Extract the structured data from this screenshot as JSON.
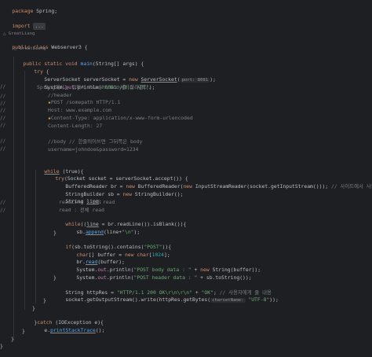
{
  "colors": {
    "background": "#1e1f22",
    "keyword": "#cf8e6d",
    "method": "#56a8f5",
    "string": "#6aab73",
    "comment": "#7a7e85",
    "number": "#2aacb8",
    "field": "#c77dbb",
    "default_text": "#bcbec4"
  },
  "code": {
    "package_kw": "package",
    "package_name": " Spring;",
    "import_kw": "import",
    "import_fold": "...",
    "author1": "△ GreatLiang",
    "class_decl": {
      "mods": "public class",
      "name": " Webserver3 {"
    },
    "author2": "△ GreatLiang",
    "main_decl": {
      "mods": "public static void",
      "name": "main",
      "args": "(String[] args) {"
    },
    "try_open": {
      "kw": "try",
      "rest": " {"
    },
    "server_socket": {
      "type": "ServerSocket serverSocket = ",
      "kw": "new",
      "cls": "ServerSocket",
      "hint": "port: 8081",
      "close": ");"
    },
    "println1": {
      "pre": "System.",
      "fld": "out",
      "post": ".println(",
      "str": "\"8081 서비스 시작\"",
      "close": ");"
    },
    "comment_spring": "Spring에서는 알아서 header/body를 잘라준다.",
    "c_header": "//header",
    "c_post": "POST /somepath HTTP/1.1",
    "c_host": "Host: www.example.com",
    "c_content_type": "Content-Type: application/x-www-form-urlencoded",
    "c_content_length": "Content-Length: 27",
    "c_body": "//body // 한줄띄어쓰면 그뒤쪽은 body",
    "c_username": "username=johndoe&password=1234",
    "while_true": {
      "kw": "while",
      "rest": " (true){"
    },
    "try_socket": {
      "kw": "try",
      "rest": "(Socket socket = serverSocket.accept()) {"
    },
    "buffered_reader": {
      "pre": "BufferedReader br = ",
      "kw1": "new",
      "mid1": " BufferedReader(",
      "kw2": "new",
      "mid2": " InputStreamReader(socket.getInputStream())); ",
      "cm": "// 사이트에서 사용자에게 입력받은 값"
    },
    "string_builder": {
      "pre": "StringBuilder sb = ",
      "kw": "new",
      "rest": " StringBuilder();"
    },
    "string_line": {
      "pre": "String ",
      "var": "line",
      "post": ";"
    },
    "c_readline": "readLine : 1줄 read",
    "c_read": "read : 전체 read",
    "while_readline": {
      "kw": "while",
      "pre": "((",
      "var": "line",
      "mid": " = br.readLine()).isBlank()){"
    },
    "append": {
      "pre": "sb.",
      "fn": "append",
      "post": "(line+",
      "str": "\"\\n\"",
      "close": ");"
    },
    "close_brace": "}",
    "if_post": {
      "kw": "if",
      "pre": "(sb.toString().contains(",
      "str": "\"POST\"",
      "close": ")){"
    },
    "char_buffer": {
      "kw1": "char",
      "pre": "[] buffer = ",
      "kw2": "new",
      "kw3": " char",
      "open": "[",
      "num": "1024",
      "close": "];"
    },
    "br_read": {
      "pre": "br.",
      "fn": "read",
      "post": "(buffer);"
    },
    "println_body": {
      "pre": "System.",
      "fld": "out",
      "post": ".println(",
      "str": "\"POST body data : \"",
      "mid": " + ",
      "kw": "new",
      "rest": " String(buffer));"
    },
    "println_header": {
      "pre": "System.",
      "fld": "out",
      "post": ".println(",
      "str": "\"POST header data : \"",
      "rest": " + sb.toString());"
    },
    "http_res": {
      "pre": "String httpRes = ",
      "str1": "\"HTTP/1.1 200 OK\\r\\n\\r\\n\"",
      "mid": " + ",
      "str2": "\"OK\"",
      "close": "; ",
      "cm": "// 사용자에게 줄 내용"
    },
    "output_stream": {
      "pre": "socket.getOutputStream().write(httpRes.getBytes(",
      "hint": "charsetName:",
      "str": "\"UTF-8\"",
      "close": "));"
    },
    "catch_line": {
      "pre": "}",
      "kw": "catch",
      "rest": " (IOException e){"
    },
    "print_stack": {
      "pre": "e.",
      "fn": "printStackTrace",
      "post": "();"
    }
  },
  "gutter_marks": {
    "m1": "//",
    "m2": "//",
    "m3": "//",
    "m4": "//",
    "m5": "//",
    "m6": "//",
    "m7": "//",
    "m8": "//",
    "m9": "//",
    "m10": "//"
  }
}
